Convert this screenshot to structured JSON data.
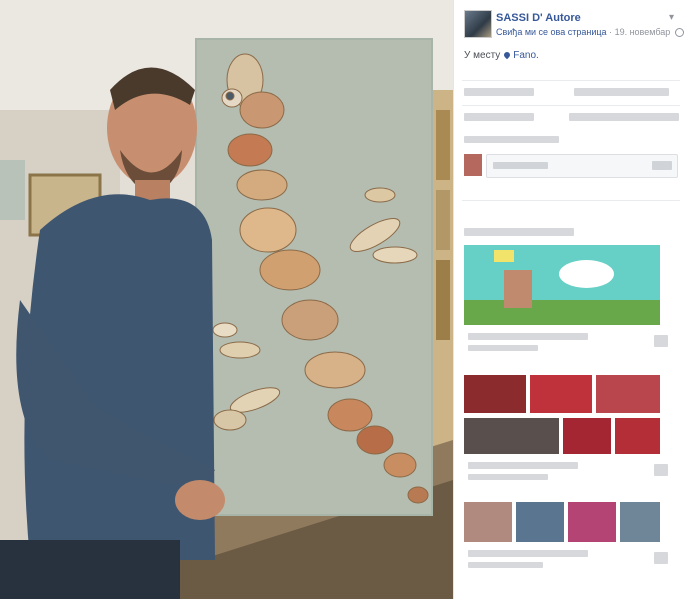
{
  "post": {
    "page_name": "SASSI D' Autore",
    "like_text": "Свиђа ми се ова страница",
    "separator": "·",
    "date": "19. новембар",
    "location_prefix": "У месту",
    "location": "Fano.",
    "menu_icon": "chevron-down-icon"
  },
  "colors": {
    "link": "#365899",
    "muted": "#90949c",
    "hero_bg": "#66d0c6"
  }
}
